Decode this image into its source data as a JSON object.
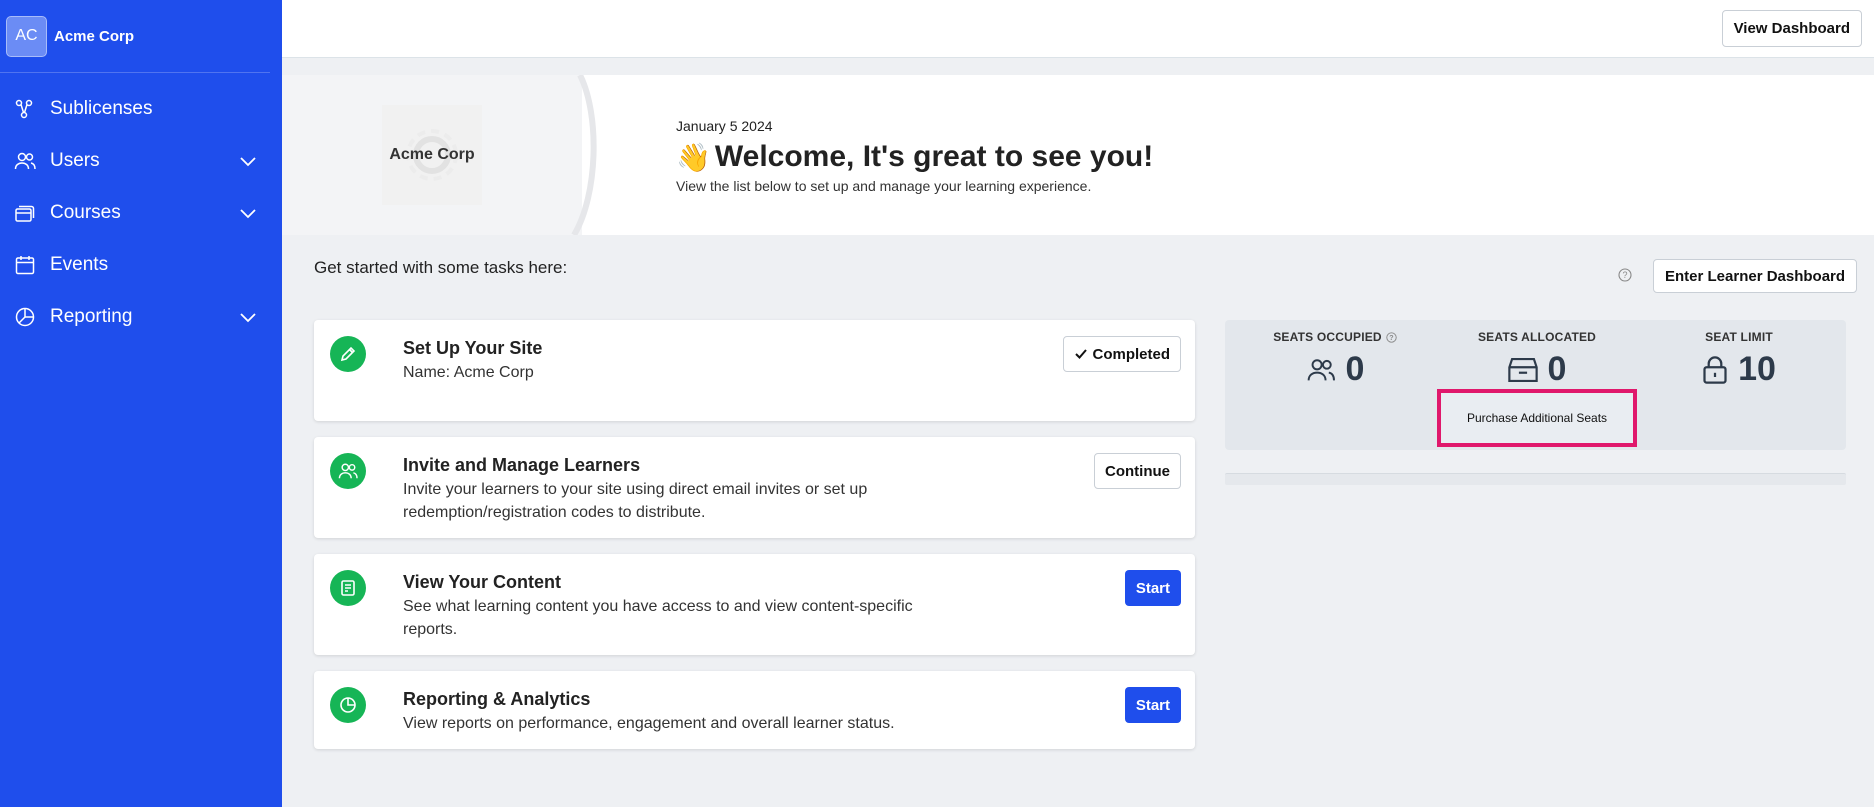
{
  "sidebar": {
    "avatar_initials": "AC",
    "org_name": "Acme Corp",
    "items": [
      {
        "label": "Sublicenses",
        "icon": "sublicenses-icon",
        "expandable": false
      },
      {
        "label": "Users",
        "icon": "users-icon",
        "expandable": true
      },
      {
        "label": "Courses",
        "icon": "courses-icon",
        "expandable": true
      },
      {
        "label": "Events",
        "icon": "calendar-icon",
        "expandable": false
      },
      {
        "label": "Reporting",
        "icon": "pie-chart-icon",
        "expandable": true
      }
    ]
  },
  "topbar": {
    "view_dashboard_label": "View Dashboard"
  },
  "hero": {
    "logo_text": "Acme Corp",
    "date": "January 5 2024",
    "wave": "👋",
    "title": "Welcome, It's great to see you!",
    "subtitle": "View the list below to set up and manage your learning experience."
  },
  "main": {
    "tasks_heading": "Get started with some tasks here:",
    "enter_learner_dashboard_label": "Enter Learner Dashboard"
  },
  "tasks": [
    {
      "title": "Set Up Your Site",
      "description": "Name: Acme Corp",
      "action": "Completed",
      "action_style": "outline-check",
      "icon": "pencil-icon"
    },
    {
      "title": "Invite and Manage Learners",
      "description": "Invite your learners to your site using direct email invites or set up redemption/registration codes to distribute.",
      "action": "Continue",
      "action_style": "outline",
      "icon": "users-icon"
    },
    {
      "title": "View Your Content",
      "description": "See what learning content you have access to and view content-specific reports.",
      "action": "Start",
      "action_style": "primary",
      "icon": "content-icon"
    },
    {
      "title": "Reporting & Analytics",
      "description": "View reports on performance, engagement and overall learner status.",
      "action": "Start",
      "action_style": "primary",
      "icon": "analytics-icon"
    }
  ],
  "seats": {
    "occupied_label": "SEATS OCCUPIED",
    "occupied_value": "0",
    "allocated_label": "SEATS ALLOCATED",
    "allocated_value": "0",
    "limit_label": "SEAT LIMIT",
    "limit_value": "10",
    "purchase_label": "Purchase Additional Seats"
  },
  "colors": {
    "sidebar_bg": "#1f4eec",
    "primary": "#1f4eec",
    "success": "#16b556",
    "highlight": "#e0186c"
  }
}
